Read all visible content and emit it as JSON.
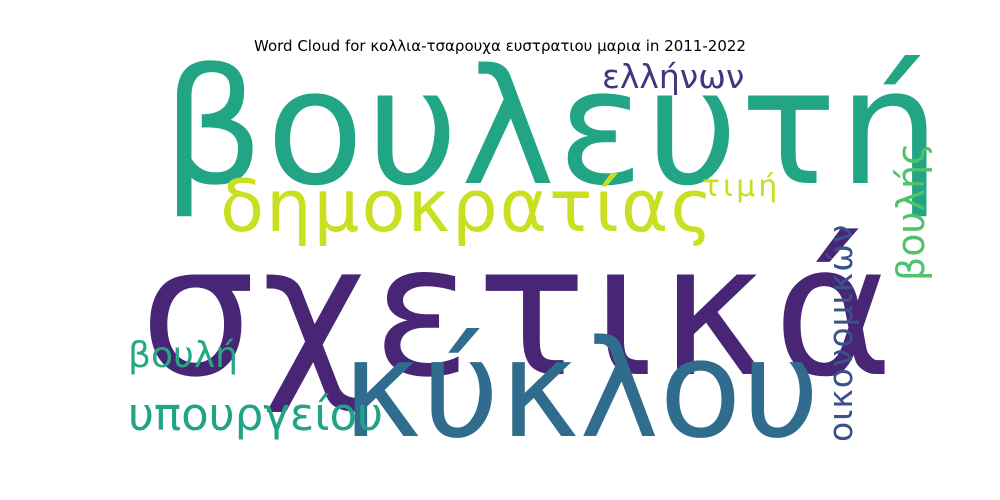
{
  "title": "Word Cloud for κολλια-τσαρουχα ευστρατιου μαρια in 2011-2022",
  "words": [
    {
      "text": "βουλευτή",
      "color": "#21a585"
    },
    {
      "text": "σχετικά",
      "color": "#482575"
    },
    {
      "text": "κύκλου",
      "color": "#2f6c8e"
    },
    {
      "text": "δημοκρατίας",
      "color": "#c8e020"
    },
    {
      "text": "ελλήνων",
      "color": "#463480"
    },
    {
      "text": "τιμή",
      "color": "#c5df21"
    },
    {
      "text": "βουλής",
      "color": "#4ec36b"
    },
    {
      "text": "οικονομικών",
      "color": "#3b518b"
    },
    {
      "text": "βουλή",
      "color": "#26a883"
    },
    {
      "text": "υπουργείου",
      "color": "#21a386"
    }
  ]
}
